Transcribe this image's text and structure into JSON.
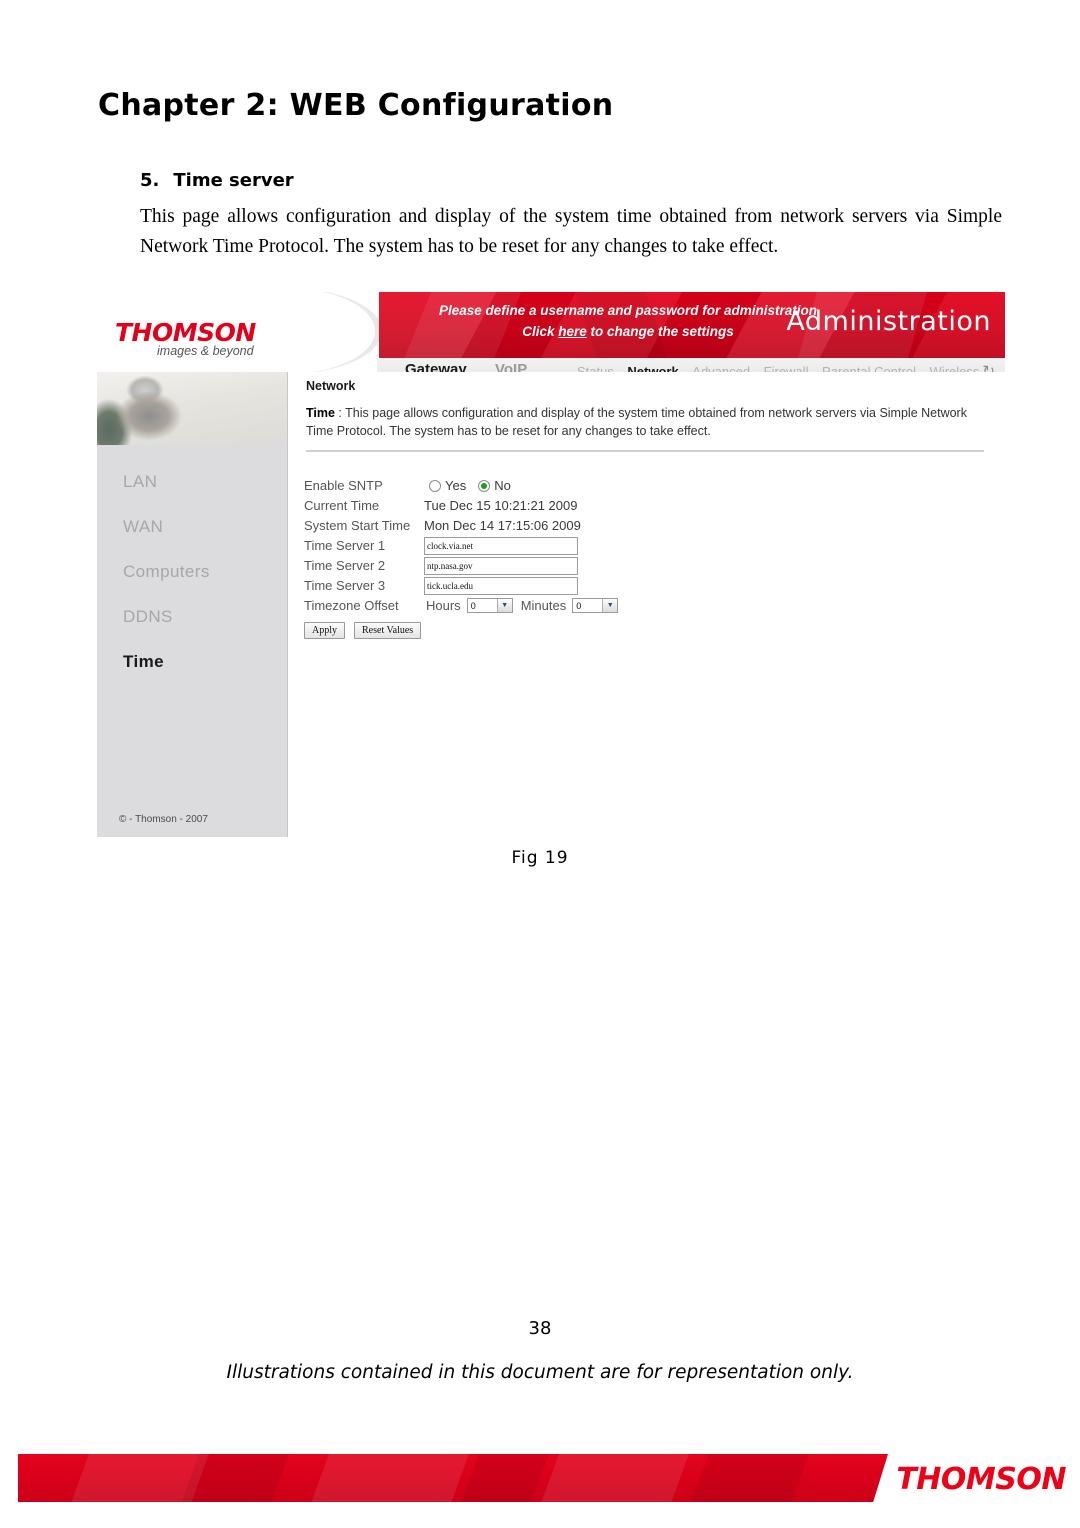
{
  "document": {
    "chapter_title": "Chapter 2: WEB Configuration",
    "section_number": "5.",
    "section_title": "Time server",
    "intro_paragraph": "This page allows configuration and display of the system time obtained from network servers via Simple Network Time Protocol. The system has to be reset for any changes to take effect.",
    "figure_caption": "Fig 19",
    "page_number": "38",
    "footer_note": "Illustrations contained in this document are for representation only."
  },
  "router_ui": {
    "banner": {
      "message_line1": "Please define a username and password for administration",
      "message_line2_pre": "Click ",
      "message_line2_link": "here",
      "message_line2_post": " to change the settings",
      "section_title": "Administration",
      "accent_color": "#e2001a"
    },
    "logo": {
      "brand": "THOMSON",
      "tagline": "images & beyond",
      "brand_color": "#e2001a"
    },
    "nav": {
      "primary": [
        {
          "label": "Gateway",
          "active": true
        },
        {
          "label": "VoIP",
          "active": false
        }
      ],
      "secondary": [
        {
          "label": "Status",
          "active": false
        },
        {
          "label": "Network",
          "active": true
        },
        {
          "label": "Advanced",
          "active": false
        },
        {
          "label": "Firewall",
          "active": false
        },
        {
          "label": "Parental Control",
          "active": false
        },
        {
          "label": "Wireless",
          "active": false
        }
      ],
      "refresh_icon": "refresh-icon"
    },
    "sidebar": {
      "items": [
        {
          "label": "LAN",
          "active": false
        },
        {
          "label": "WAN",
          "active": false
        },
        {
          "label": "Computers",
          "active": false
        },
        {
          "label": "DDNS",
          "active": false
        },
        {
          "label": "Time",
          "active": true
        }
      ],
      "copyright": "© - Thomson - 2007"
    },
    "content": {
      "kicker": "Network",
      "desc_label": "Time",
      "desc_separator": " :  ",
      "desc_text": "This page allows configuration and display of the system time obtained from network servers via Simple Network Time Protocol. The system has to be reset for any changes to take effect."
    },
    "form": {
      "enable_sntp": {
        "label": "Enable SNTP",
        "option_yes": "Yes",
        "option_no": "No",
        "selected": "No"
      },
      "current_time": {
        "label": "Current Time",
        "value": "Tue Dec 15 10:21:21 2009"
      },
      "system_start_time": {
        "label": "System Start Time",
        "value": "Mon Dec 14 17:15:06 2009"
      },
      "time_server_1": {
        "label": "Time Server 1",
        "value": "clock.via.net"
      },
      "time_server_2": {
        "label": "Time Server 2",
        "value": "ntp.nasa.gov"
      },
      "time_server_3": {
        "label": "Time Server 3",
        "value": "tick.ucla.edu"
      },
      "timezone_offset": {
        "label": "Timezone Offset",
        "hours_label": "Hours",
        "hours_value": "0",
        "minutes_label": "Minutes",
        "minutes_value": "0"
      },
      "apply_button": "Apply",
      "reset_button": "Reset Values"
    }
  },
  "footer_banner": {
    "brand": "THOMSON",
    "brand_color": "#ee0016"
  }
}
